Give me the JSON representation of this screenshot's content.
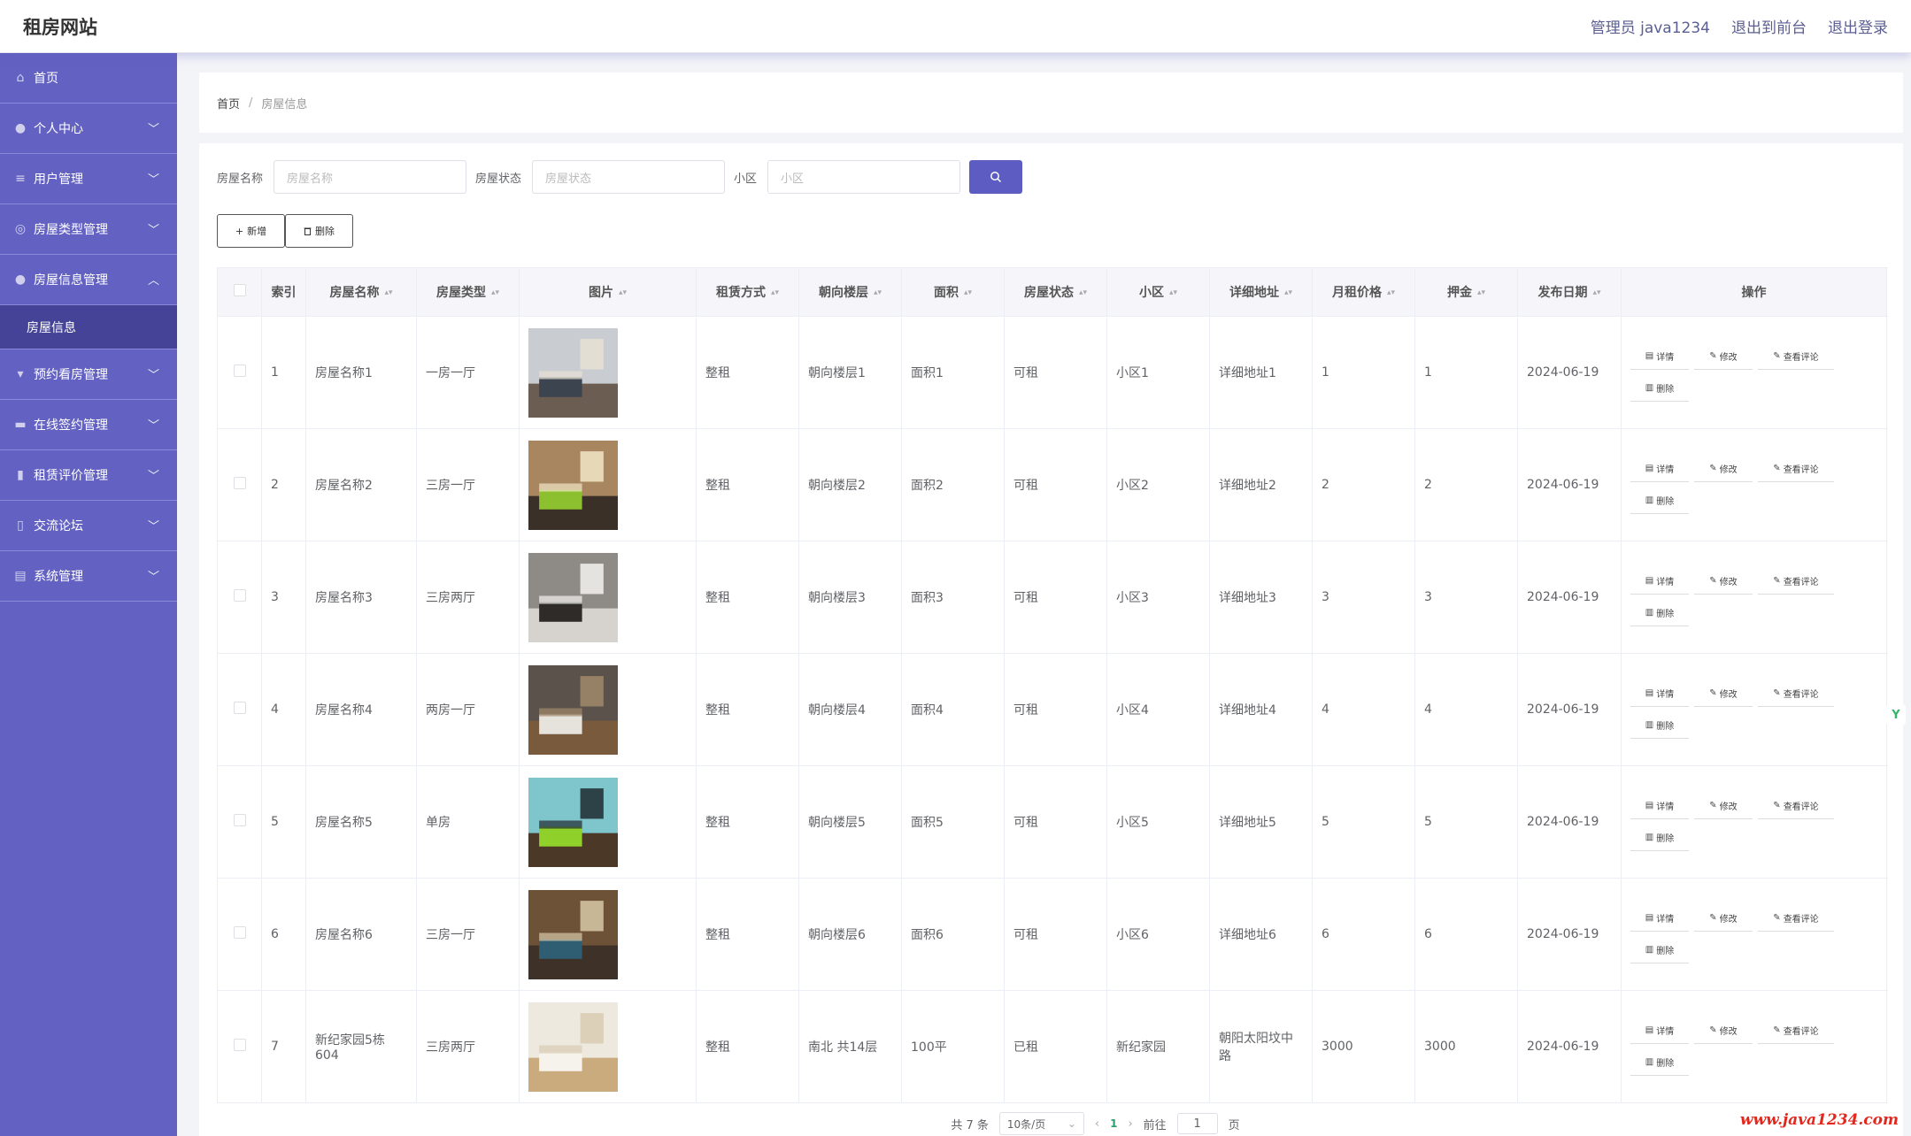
{
  "header": {
    "title": "租房网站",
    "admin_label": "管理员 java1234",
    "goto_front": "退出到前台",
    "logout": "退出登录"
  },
  "sidebar": {
    "items": [
      {
        "label": "首页",
        "icon": "home-icon",
        "expandable": false
      },
      {
        "label": "个人中心",
        "icon": "user-icon",
        "expandable": true
      },
      {
        "label": "用户管理",
        "icon": "sliders-icon",
        "expandable": true
      },
      {
        "label": "房屋类型管理",
        "icon": "circle-icon",
        "expandable": true
      },
      {
        "label": "房屋信息管理",
        "icon": "user-icon",
        "expandable": true,
        "open": true,
        "children": [
          {
            "label": "房屋信息"
          }
        ]
      },
      {
        "label": "预约看房管理",
        "icon": "cup-icon",
        "expandable": true
      },
      {
        "label": "在线签约管理",
        "icon": "monitor-icon",
        "expandable": true
      },
      {
        "label": "租赁评价管理",
        "icon": "chart-icon",
        "expandable": true
      },
      {
        "label": "交流论坛",
        "icon": "phone-icon",
        "expandable": true
      },
      {
        "label": "系统管理",
        "icon": "briefcase-icon",
        "expandable": true
      }
    ]
  },
  "breadcrumb": {
    "home": "首页",
    "sep": "/",
    "current": "房屋信息"
  },
  "search": {
    "name_label": "房屋名称",
    "name_placeholder": "房屋名称",
    "status_label": "房屋状态",
    "status_placeholder": "房屋状态",
    "community_label": "小区",
    "community_placeholder": "小区"
  },
  "actions": {
    "add": "新增",
    "delete": "删除"
  },
  "table": {
    "headers": [
      "索引",
      "房屋名称",
      "房屋类型",
      "图片",
      "租赁方式",
      "朝向楼层",
      "面积",
      "房屋状态",
      "小区",
      "详细地址",
      "月租价格",
      "押金",
      "发布日期",
      "操作"
    ],
    "row_ops": {
      "detail": "详情",
      "edit": "修改",
      "comments": "查看评论",
      "delete": "删除"
    },
    "rows": [
      {
        "index": "1",
        "name": "房屋名称1",
        "type": "一房一厅",
        "lease": "整租",
        "floor": "朝向楼层1",
        "area": "面积1",
        "status": "可租",
        "community": "小区1",
        "address": "详细地址1",
        "price": "1",
        "deposit": "1",
        "date": "2024-06-19",
        "img": {
          "wall": "#c9cdd2",
          "floor": "#6b5d52",
          "bed": "#3c4450",
          "accent": "#e8e1d4"
        }
      },
      {
        "index": "2",
        "name": "房屋名称2",
        "type": "三房一厅",
        "lease": "整租",
        "floor": "朝向楼层2",
        "area": "面积2",
        "status": "可租",
        "community": "小区2",
        "address": "详细地址2",
        "price": "2",
        "deposit": "2",
        "date": "2024-06-19",
        "img": {
          "wall": "#a88760",
          "floor": "#3b3028",
          "bed": "#8cc02f",
          "accent": "#f2e6c8"
        }
      },
      {
        "index": "3",
        "name": "房屋名称3",
        "type": "三房两厅",
        "lease": "整租",
        "floor": "朝向楼层3",
        "area": "面积3",
        "status": "可租",
        "community": "小区3",
        "address": "详细地址3",
        "price": "3",
        "deposit": "3",
        "date": "2024-06-19",
        "img": {
          "wall": "#8e8a86",
          "floor": "#d6d3cf",
          "bed": "#2e2b28",
          "accent": "#f4f2ee"
        }
      },
      {
        "index": "4",
        "name": "房屋名称4",
        "type": "两房一厅",
        "lease": "整租",
        "floor": "朝向楼层4",
        "area": "面积4",
        "status": "可租",
        "community": "小区4",
        "address": "详细地址4",
        "price": "4",
        "deposit": "4",
        "date": "2024-06-19",
        "img": {
          "wall": "#5b524b",
          "floor": "#7a5a3c",
          "bed": "#e6e2dc",
          "accent": "#a2896b"
        }
      },
      {
        "index": "5",
        "name": "房屋名称5",
        "type": "单房",
        "lease": "整租",
        "floor": "朝向楼层5",
        "area": "面积5",
        "status": "可租",
        "community": "小区5",
        "address": "详细地址5",
        "price": "5",
        "deposit": "5",
        "date": "2024-06-19",
        "img": {
          "wall": "#7fc5cc",
          "floor": "#4c3826",
          "bed": "#8fd12a",
          "accent": "#1f2a2f"
        }
      },
      {
        "index": "6",
        "name": "房屋名称6",
        "type": "三房一厅",
        "lease": "整租",
        "floor": "朝向楼层6",
        "area": "面积6",
        "status": "可租",
        "community": "小区6",
        "address": "详细地址6",
        "price": "6",
        "deposit": "6",
        "date": "2024-06-19",
        "img": {
          "wall": "#6d5238",
          "floor": "#3d3128",
          "bed": "#2f5e73",
          "accent": "#d8c9a8"
        }
      },
      {
        "index": "7",
        "name": "新纪家园5栋604",
        "type": "三房两厅",
        "lease": "整租",
        "floor": "南北 共14层",
        "area": "100平",
        "status": "已租",
        "community": "新纪家园",
        "address": "朝阳太阳坟中路",
        "price": "3000",
        "deposit": "3000",
        "date": "2024-06-19",
        "img": {
          "wall": "#ede9df",
          "floor": "#c9ab7d",
          "bed": "#f6f3ec",
          "accent": "#d8cbb2"
        }
      }
    ]
  },
  "pager": {
    "total": "共 7 条",
    "page_size": "10条/页",
    "current_page": "1",
    "goto": "前往",
    "goto_value": "1",
    "page_unit": "页"
  },
  "watermark": "www.java1234.com",
  "colors": {
    "sidebar": "#6362c3",
    "sidebar_active": "#444397",
    "primary": "#5c5cc2"
  }
}
